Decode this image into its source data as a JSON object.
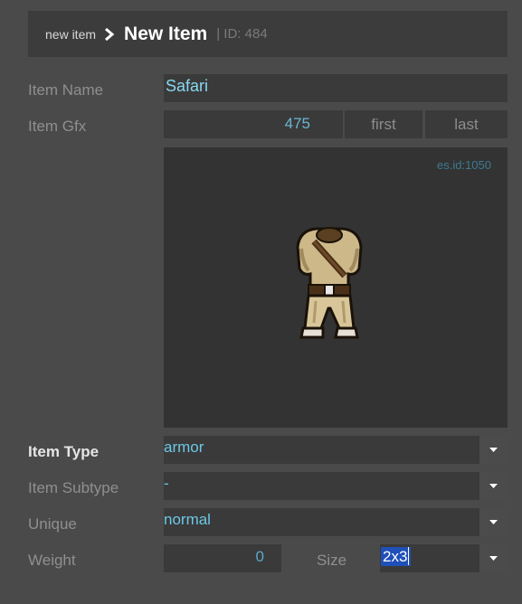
{
  "header": {
    "breadcrumb": "new item",
    "title": "New Item",
    "id_label": "| ID: 484"
  },
  "fields": {
    "item_name": {
      "label": "Item Name",
      "value": "Safari"
    },
    "item_gfx": {
      "label": "Item Gfx",
      "value": "475",
      "first_label": "first",
      "last_label": "last"
    },
    "preview": {
      "resource_id": "es.id:1050",
      "image": "safari armor sprite"
    },
    "item_type": {
      "label": "Item Type",
      "value": "armor"
    },
    "item_subtype": {
      "label": "Item Subtype",
      "value": "-"
    },
    "unique": {
      "label": "Unique",
      "value": "normal"
    },
    "weight": {
      "label": "Weight",
      "value": "0"
    },
    "size": {
      "label": "Size",
      "value": "2x3"
    }
  },
  "icons": {
    "breadcrumb_separator": "chevron-right-icon",
    "dropdown": "chevron-down-icon"
  },
  "colors": {
    "background": "#4a4a4a",
    "field": "#3a3a3a",
    "value_text": "#6cc7e6",
    "selection": "#1f4fb8"
  }
}
